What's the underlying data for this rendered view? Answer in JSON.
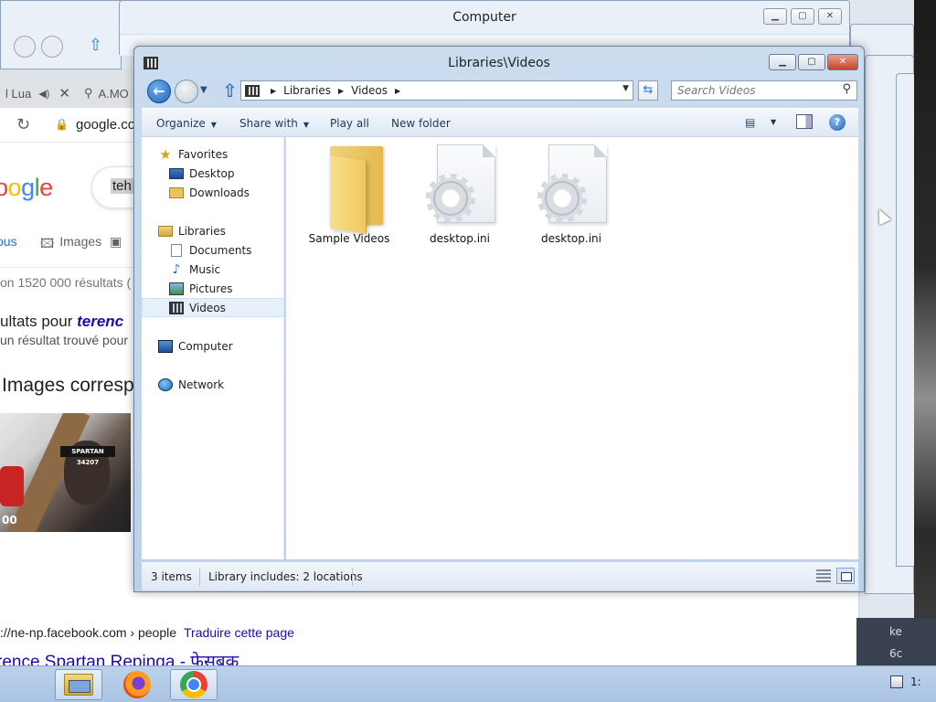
{
  "browser": {
    "tab1_title": "l Lua",
    "tab1_close": "✕",
    "tab2_title": "A.MO",
    "address": "google.com",
    "search_query": "teh",
    "tab_all": "ous",
    "tab_images": "Images",
    "results_count": "on 1520 000 résultats (",
    "result_heading_prefix": "ultats pour ",
    "result_heading_term": "terenc",
    "result_subline": "un résultat trouvé pour",
    "images_heading": "Images corresp",
    "image_band_text": "SPARTAN 34207",
    "image_watermark": "00",
    "result_url": "://ne-np.facebook.com › people",
    "result_translate": "Traduire cette page",
    "result_title": "rence Spartan Repinga - फेसबुक"
  },
  "computer_window": {
    "title": "Computer"
  },
  "explorer": {
    "title": "Libraries\\Videos",
    "breadcrumb": [
      "Libraries",
      "Videos"
    ],
    "search_placeholder": "Search Videos",
    "commands": {
      "organize": "Organize",
      "share_with": "Share with",
      "play_all": "Play all",
      "new_folder": "New folder"
    },
    "nav": {
      "favorites": "Favorites",
      "desktop": "Desktop",
      "downloads": "Downloads",
      "libraries": "Libraries",
      "documents": "Documents",
      "music": "Music",
      "pictures": "Pictures",
      "videos": "Videos",
      "computer": "Computer",
      "network": "Network"
    },
    "files": [
      {
        "name": "Sample Videos",
        "type": "folder"
      },
      {
        "name": "desktop.ini",
        "type": "settings-file"
      },
      {
        "name": "desktop.ini",
        "type": "settings-file"
      }
    ],
    "status": {
      "items": "3 items",
      "library_info": "Library includes: 2 locations"
    }
  },
  "right_strip": {
    "line1": "ke",
    "line2": "6c"
  },
  "tray": {
    "clock": "1:"
  },
  "colors": {
    "accent": "#1d62b7",
    "close_button": "#c4432c",
    "selection": "#e5f0fb"
  }
}
